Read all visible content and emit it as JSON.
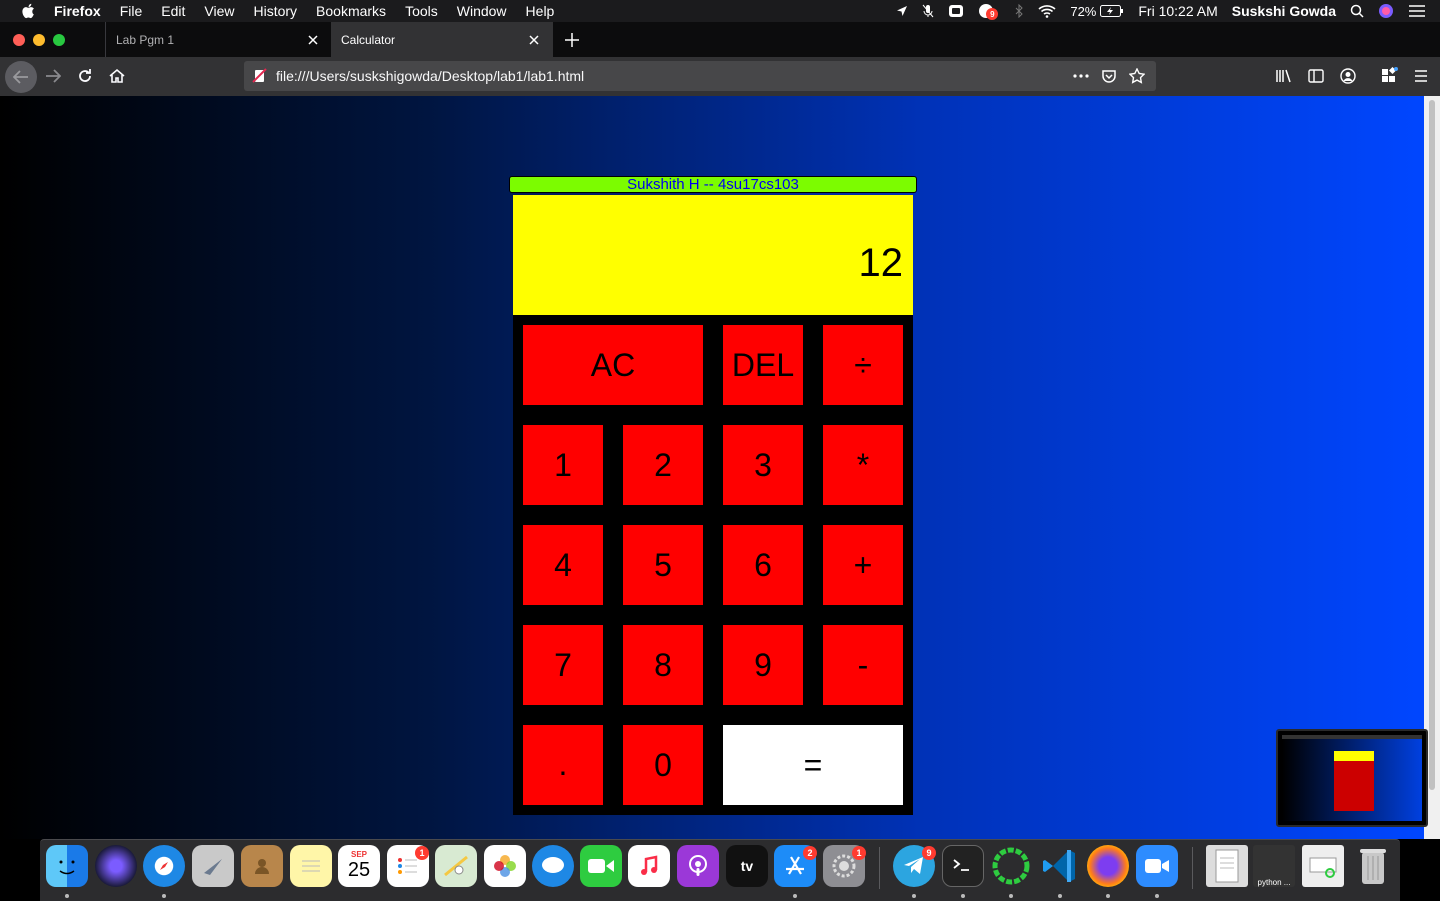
{
  "menubar": {
    "app_name": "Firefox",
    "items": [
      "File",
      "Edit",
      "View",
      "History",
      "Bookmarks",
      "Tools",
      "Window",
      "Help"
    ],
    "battery": "72%",
    "clock": "Fri 10:22 AM",
    "user": "Suskshi Gowda",
    "notification_badge": "9"
  },
  "tabs": [
    {
      "label": "Lab Pgm 1",
      "active": false
    },
    {
      "label": "Calculator",
      "active": true
    }
  ],
  "urlbar": {
    "url": "file:///Users/suskshigowda/Desktop/lab1/lab1.html"
  },
  "page": {
    "header": "Sukshith H -- 4su17cs103",
    "display_value": "12",
    "keys": {
      "ac": "AC",
      "del": "DEL",
      "divide": "÷",
      "k1": "1",
      "k2": "2",
      "k3": "3",
      "multiply": "*",
      "k4": "4",
      "k5": "5",
      "k6": "6",
      "plus": "+",
      "k7": "7",
      "k8": "8",
      "k9": "9",
      "minus": "-",
      "dot": ".",
      "k0": "0",
      "equals": "="
    },
    "colors": {
      "header_bg": "#7cfc00",
      "header_text": "#0000ee",
      "display_bg": "#ffff00",
      "key_bg": "#ff0000",
      "equals_bg": "#ffffff",
      "pad_bg": "#000000"
    }
  },
  "dock": {
    "calendar_month": "SEP",
    "calendar_day": "25",
    "badges": {
      "reminders": "1",
      "appstore": "2",
      "settings": "1",
      "telegram": "9"
    },
    "tv_label": "tv",
    "python_label": "python ..."
  }
}
